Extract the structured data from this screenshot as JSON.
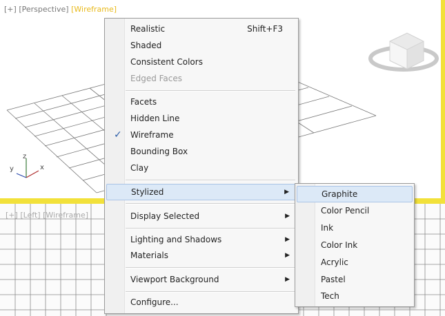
{
  "viewports": {
    "perspective": {
      "plus": "[+]",
      "view": "[Perspective]",
      "mode": "[Wireframe]"
    },
    "left": {
      "plus": "[+]",
      "view": "[Left]",
      "mode": "[Wireframe]"
    }
  },
  "axis": {
    "x": "x",
    "y": "y",
    "z": "z"
  },
  "context_menu": {
    "items": [
      {
        "label": "Realistic",
        "shortcut": "Shift+F3"
      },
      {
        "label": "Shaded"
      },
      {
        "label": "Consistent Colors"
      },
      {
        "label": "Edged Faces",
        "disabled": true
      },
      {
        "label": "Facets"
      },
      {
        "label": "Hidden Line"
      },
      {
        "label": "Wireframe",
        "checked": true,
        "check": "✓"
      },
      {
        "label": "Bounding Box"
      },
      {
        "label": "Clay"
      },
      {
        "label": "Stylized",
        "submenu": true
      },
      {
        "label": "Display Selected",
        "submenu": true
      },
      {
        "label": "Lighting and Shadows",
        "submenu": true
      },
      {
        "label": "Materials",
        "submenu": true
      },
      {
        "label": "Viewport Background",
        "submenu": true
      },
      {
        "label": "Configure..."
      }
    ],
    "arrow": "▶"
  },
  "stylized_submenu": {
    "items": [
      "Graphite",
      "Color Pencil",
      "Ink",
      "Color Ink",
      "Acrylic",
      "Pastel",
      "Tech"
    ]
  },
  "colors": {
    "active_border": "#f2e13a",
    "highlight": "#dce9f7"
  },
  "icons": [
    "viewcube-icon",
    "axis-tripod-icon",
    "check-icon",
    "submenu-arrow-icon"
  ]
}
